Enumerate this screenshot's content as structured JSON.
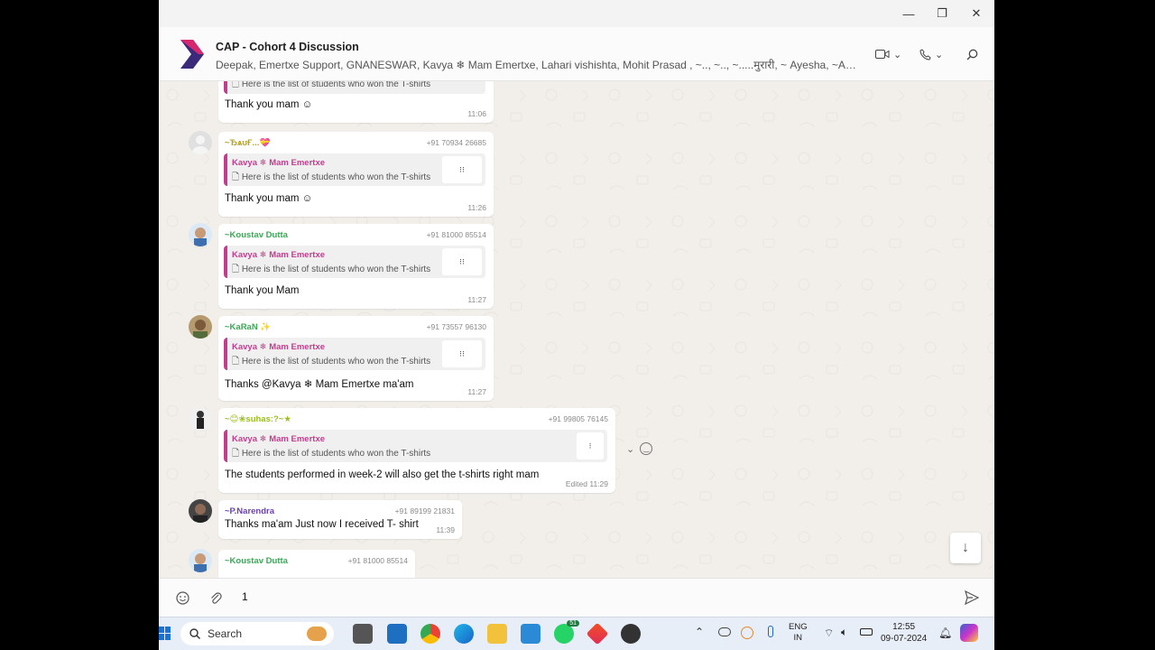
{
  "window": {
    "minimize_glyph": "—",
    "maximize_glyph": "❐",
    "close_glyph": "✕"
  },
  "header": {
    "title": "CAP - Cohort 4 Discussion",
    "members": "Deepak, Emertxe Support, GNANESWAR, Kavya ❄ Mam Emertxe, Lahari vishishta, Mohit Prasad , ~.., ~.., ~.....मुरारी, ~ Ayesha, ~A.Nirmal..."
  },
  "quote": {
    "author": "Kavya ❄ Mam Emertxe",
    "text": "Here is the list of students who won the T-shirts"
  },
  "messages": [
    {
      "sender": "",
      "phone": "",
      "text": "Thank you mam ☺",
      "time": "11:06"
    },
    {
      "sender": "~ЂѧʊҒ...💝",
      "phone": "+91 70934 26685",
      "text": "Thank you mam ☺",
      "time": "11:26"
    },
    {
      "sender": "~Koustav Dutta",
      "phone": "+91 81000 85514",
      "text": "Thank you Mam",
      "time": "11:27"
    },
    {
      "sender": "~KaRaN ✨",
      "phone": "+91 73557 96130",
      "text": "Thanks @Kavya ❄ Mam Emertxe ma'am",
      "time": "11:27"
    },
    {
      "sender": "~😊❀suhas:?~★",
      "phone": "+91 99805 76145",
      "text": "The students performed in week-2 will also get the t-shirts right mam",
      "time": "Edited 11:29"
    },
    {
      "sender": "~P.Narendra",
      "phone": "+91 89199 21831",
      "text": "Thanks ma'am Just now I  received T- shirt",
      "time": "11:39"
    },
    {
      "sender": "~Koustav Dutta",
      "phone": "+91 81000 85514",
      "text": "",
      "time": ""
    }
  ],
  "composer": {
    "value": "1"
  },
  "taskbar": {
    "search_label": "Search",
    "whatsapp_badge": "51",
    "lang_top": "ENG",
    "lang_bottom": "IN",
    "clock_time": "12:55",
    "clock_date": "09-07-2024"
  },
  "colors": {
    "accent_pink": "#c53c8f",
    "sender_green": "#3aa856",
    "sender_yellow": "#b8a318",
    "sender_purple": "#6b3fb0"
  }
}
